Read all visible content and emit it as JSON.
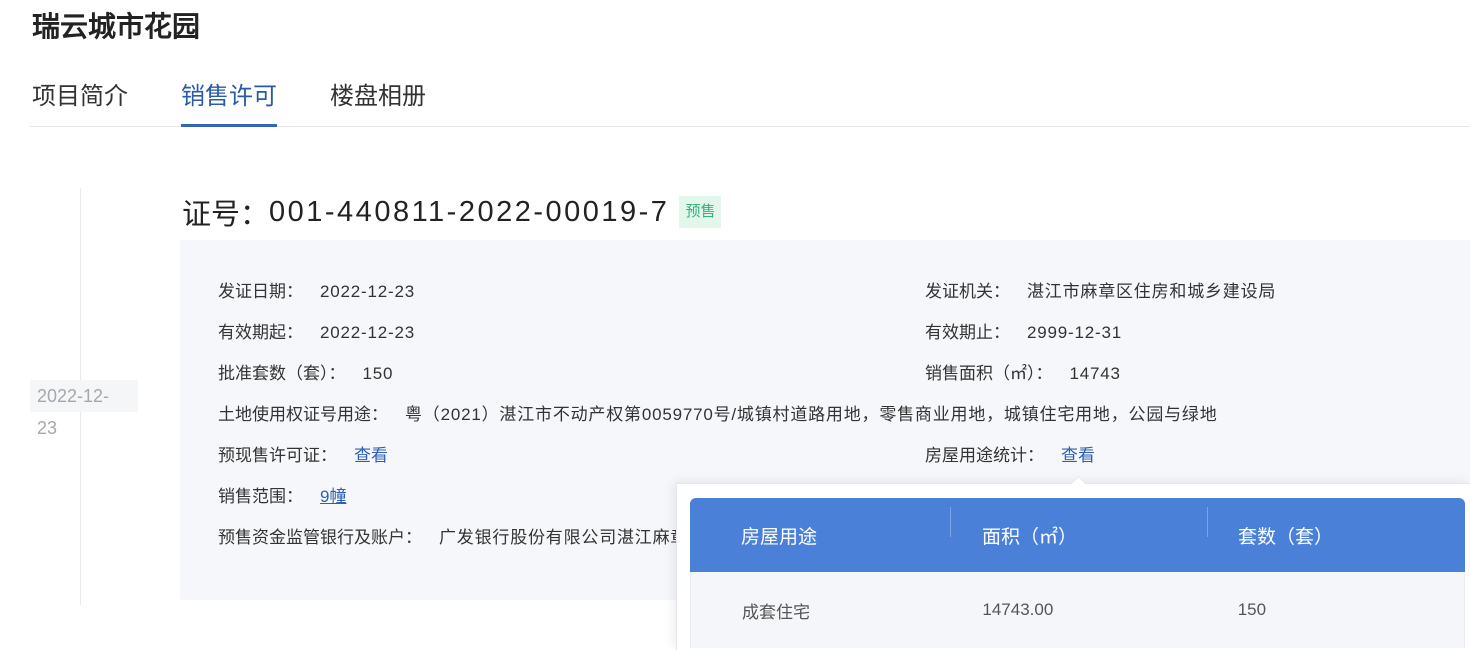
{
  "project": {
    "title": "瑞云城市花园"
  },
  "tabs": [
    {
      "label": "项目简介",
      "active": false
    },
    {
      "label": "销售许可",
      "active": true
    },
    {
      "label": "楼盘相册",
      "active": false
    }
  ],
  "permit": {
    "timeline_date": "2022-12-23",
    "number_label": "证号：",
    "number": "001-440811-2022-00019-7",
    "badge": "预售",
    "fields": {
      "issue_date": {
        "label": "发证日期：",
        "value": "2022-12-23"
      },
      "issuer": {
        "label": "发证机关：",
        "value": "湛江市麻章区住房和城乡建设局"
      },
      "valid_from": {
        "label": "有效期起：",
        "value": "2022-12-23"
      },
      "valid_to": {
        "label": "有效期止：",
        "value": "2999-12-31"
      },
      "approved_units": {
        "label": "批准套数（套）：",
        "value": "150"
      },
      "sale_area": {
        "label": "销售面积（㎡）：",
        "value": "14743"
      },
      "land_use": {
        "label": "土地使用权证号用途：",
        "value": "粤（2021）湛江市不动产权第0059770号/城镇村道路用地，零售商业用地，城镇住宅用地，公园与绿地"
      },
      "presale_license": {
        "label": "预现售许可证：",
        "link": "查看"
      },
      "usage_stats": {
        "label": "房屋用途统计：",
        "link": "查看"
      },
      "sale_scope": {
        "label": "销售范围：",
        "link": "9幢"
      },
      "escrow_account": {
        "label": "预售资金监管银行及账户：",
        "value": "广发银行股份有限公司湛江麻章"
      }
    }
  },
  "usage_popup": {
    "columns": [
      "房屋用途",
      "面积（㎡）",
      "套数（套）"
    ],
    "rows": [
      [
        "成套住宅",
        "14743.00",
        "150"
      ]
    ]
  },
  "colors": {
    "accent": "#2f5fb3",
    "tab_active": "#2b5aa6",
    "table_header": "#4a80d8",
    "badge_text": "#34b27b",
    "badge_bg": "#e2f6ea",
    "panel_bg": "#f5f7fa"
  }
}
